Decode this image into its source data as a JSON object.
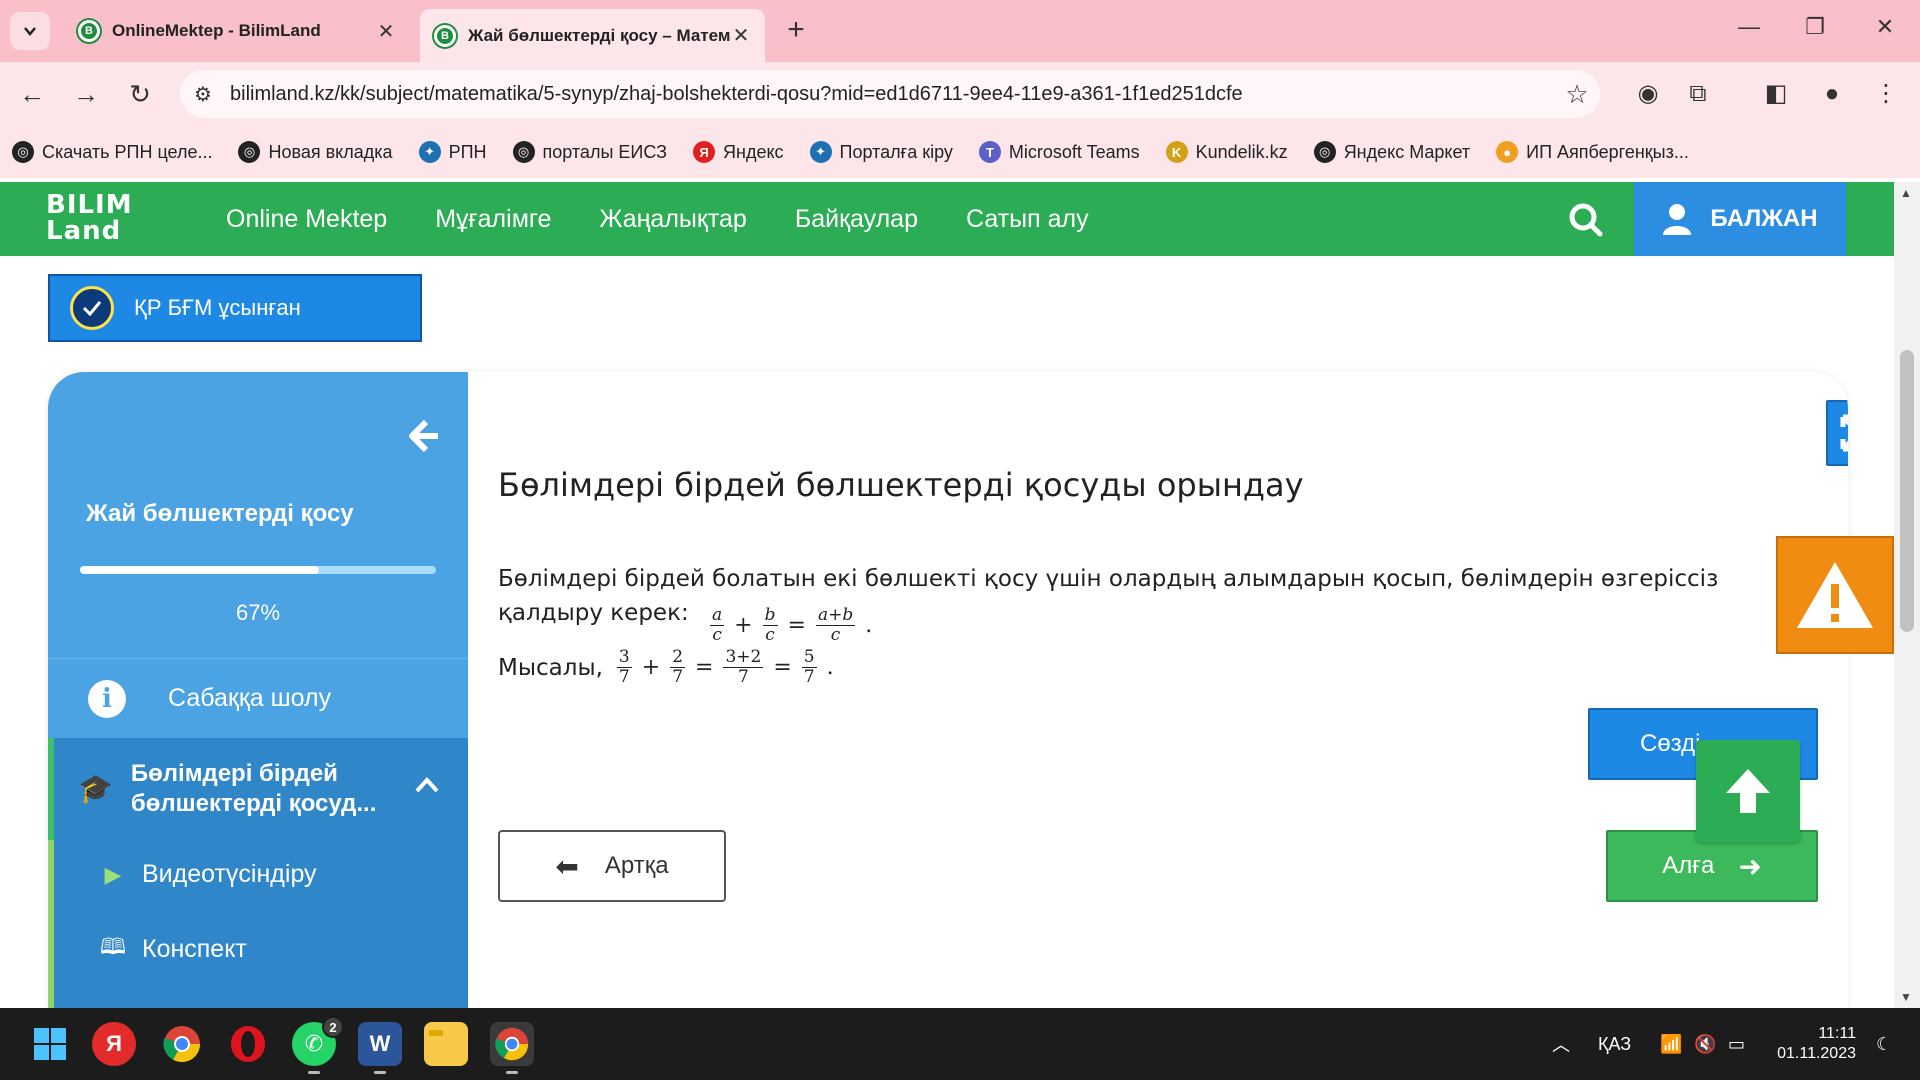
{
  "browser": {
    "tabs": [
      {
        "title": "OnlineMektep - BilimLand",
        "active": false
      },
      {
        "title": "Жай бөлшектерді қосу – Математика",
        "active": true
      }
    ],
    "new_tab": "+",
    "url": "bilimland.kz/kk/subject/matematika/5-synyp/zhaj-bolshekterdi-qosu?mid=ed1d6711-9ee4-11e9-a361-1f1ed251dcfe",
    "bookmarks": [
      {
        "label": "Скачать РПН целе...",
        "icon": "chrome-favicon",
        "color": "#222222"
      },
      {
        "label": "Новая вкладка",
        "icon": "chrome-favicon",
        "color": "#222222"
      },
      {
        "label": "РПН",
        "icon": "rpn-favicon",
        "color": "#1f6fb5"
      },
      {
        "label": "порталы ЕИСЗ",
        "icon": "chrome-favicon",
        "color": "#222222"
      },
      {
        "label": "Яндекс",
        "icon": "yandex-favicon",
        "color": "#e02020"
      },
      {
        "label": "Порталға кіру",
        "icon": "portal-favicon",
        "color": "#1f6fb5"
      },
      {
        "label": "Microsoft Teams",
        "icon": "teams-favicon",
        "color": "#5b5fc7"
      },
      {
        "label": "Kundelik.kz",
        "icon": "kundelik-favicon",
        "color": "#d4a017"
      },
      {
        "label": "Яндекс Маркет",
        "icon": "chrome-favicon",
        "color": "#222222"
      },
      {
        "label": "ИП Аяпбергенқыз...",
        "icon": "ip-favicon",
        "color": "#f0a020"
      }
    ]
  },
  "site": {
    "logo_line1": "BILIM",
    "logo_line2": "Land",
    "nav": [
      "Online Mektep",
      "Мұғалімге",
      "Жаңалықтар",
      "Байқаулар",
      "Сатып алу"
    ],
    "user_name": "БАЛЖАН",
    "badge": "ҚР БҒМ ұсынған",
    "colors": {
      "green": "#2cad55",
      "blue": "#1e88e5",
      "sidebar": "#4ba3e4",
      "orange": "#f08c12"
    }
  },
  "sidebar": {
    "title": "Жай бөлшектерді қосу",
    "progress": 0.67,
    "progress_text": "67%",
    "overview": "Сабаққа шолу",
    "current_section": "Бөлімдері бірдей бөлшектерді қосуд...",
    "items": [
      {
        "label": "Видеотүсіндіру",
        "icon": "play-icon"
      },
      {
        "label": "Конспект",
        "icon": "book-icon"
      }
    ]
  },
  "lesson": {
    "heading": "Бөлімдері бірдей бөлшектерді қосуды орындау",
    "para1": "Бөлімдері бірдей болатын екі бөлшекті қосу үшін олардың алымдарын қосып, бөлімдерін өзгеріссіз қалдыру керек:",
    "formula": {
      "a": "a",
      "b": "b",
      "c": "c",
      "sum_num": "a+b"
    },
    "example_label": "Мысалы,",
    "example": {
      "n1": "3",
      "n2": "2",
      "d": "7",
      "sum_num": "3+2",
      "result_num": "5"
    },
    "plus": "+",
    "equals": "=",
    "period": "."
  },
  "buttons": {
    "vocab": "Сөзді",
    "back": "Артқа",
    "next": "Алға"
  },
  "taskbar": {
    "lang": "ҚАЗ",
    "time": "11:11",
    "date": "01.11.2023",
    "whatsapp_badge": "2"
  }
}
